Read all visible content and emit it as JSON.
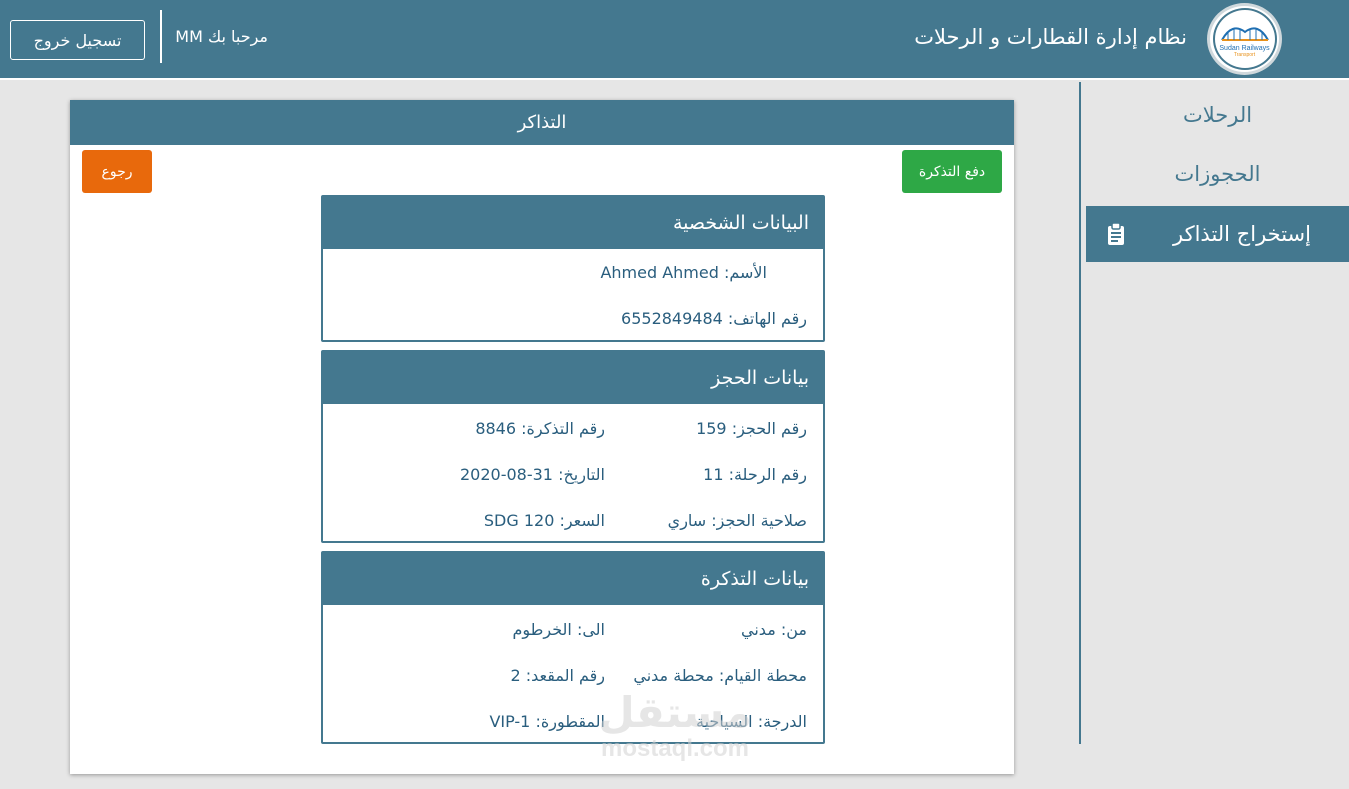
{
  "header": {
    "logo_text": "Sudan Railways",
    "logo_sub": "Transport",
    "title": "نظام إدارة القطارات و الرحلات",
    "welcome": "مرحبا بك MM",
    "logout_label": "تسجيل خروج"
  },
  "sidebar": {
    "items": [
      {
        "label": "الرحلات",
        "active": false
      },
      {
        "label": "الحجوزات",
        "active": false
      },
      {
        "label": "إستخراج التذاكر",
        "active": true,
        "icon": "clipboard-icon"
      }
    ]
  },
  "main": {
    "title": "التذاكر",
    "pay_label": "دفع التذكرة",
    "back_label": "رجوع",
    "personal": {
      "heading": "البيانات الشخصية",
      "name": "الأسم: Ahmed Ahmed",
      "phone": "رقم الهاتف: 6552849484"
    },
    "booking": {
      "heading": "بيانات الحجز",
      "booking_no": "رقم الحجز: 159",
      "ticket_no": "رقم التذكرة: 8846",
      "trip_no": "رقم الرحلة: 11",
      "date": "التاريخ: 31-08-2020",
      "validity": "صلاحية الحجز: ساري",
      "price": "السعر: SDG 120"
    },
    "ticket": {
      "heading": "بيانات التذكرة",
      "from": "من: مدني",
      "to": "الى: الخرطوم",
      "station": "محطة القيام: محطة مدني",
      "seat": "رقم المقعد: 2",
      "class": "الدرجة: السياحية",
      "coach": "المقطورة: VIP-1"
    }
  },
  "watermark": {
    "arabic": "مستقل",
    "latin": "mostaql.com"
  },
  "colors": {
    "primary": "#44788f",
    "pay": "#2ea846",
    "back": "#e8690c",
    "text": "#2a5e7e",
    "background": "#e6e6e6"
  }
}
